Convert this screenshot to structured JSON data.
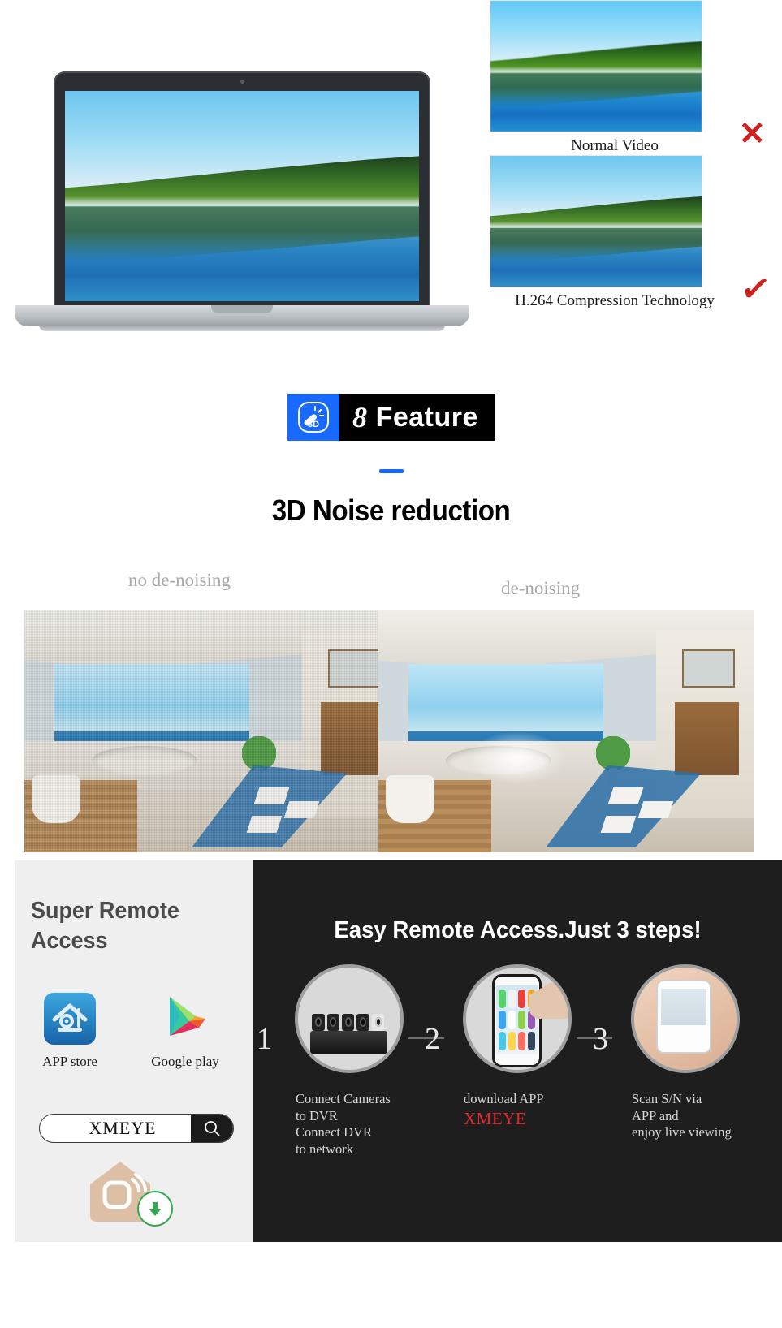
{
  "comparison": {
    "items": [
      {
        "caption": "Normal Video",
        "mark": "✕",
        "mark_name": "cross-mark",
        "quality": "normal"
      },
      {
        "caption": "H.264 Compression Technology",
        "mark": "✓",
        "mark_name": "check-mark",
        "quality": "compressed"
      }
    ],
    "mark_color": "#cf1f1f"
  },
  "feature_badge": {
    "icon_label": "3D",
    "number": "8",
    "label": "Feature",
    "icon_bg": "#1769ff",
    "label_bg": "#000000"
  },
  "noise_section": {
    "rule_color": "#1769ff",
    "title": "3D Noise reduction",
    "left_label": "no de-noising",
    "right_label": "de-noising"
  },
  "remote": {
    "left": {
      "title": "Super Remote Access",
      "stores": [
        {
          "name": "APP store",
          "icon": "xmeye-app-icon"
        },
        {
          "name": "Google play",
          "icon": "google-play-icon"
        }
      ],
      "search": {
        "value": "XMEYE",
        "placeholder": "XMEYE",
        "button_icon": "search-icon"
      },
      "download": {
        "icon": "xmeye-house-icon",
        "badge_icon": "download-arrow-icon",
        "badge_color": "#2fa84f"
      }
    },
    "right": {
      "title": "Easy Remote Access.Just 3 steps!",
      "steps": [
        {
          "number": "1",
          "image": "dvr-with-cameras",
          "lines": [
            "Connect Cameras",
            "to DVR",
            "Connect DVR",
            "to network"
          ],
          "highlight": ""
        },
        {
          "number": "2",
          "image": "smartphone-apps",
          "lines": [
            "download APP"
          ],
          "highlight": "XMEYE"
        },
        {
          "number": "3",
          "image": "hand-holding-phone",
          "lines": [
            "Scan S/N via",
            "APP and",
            "enjoy live viewing"
          ],
          "highlight": ""
        }
      ],
      "highlight_color": "#e8262d"
    }
  }
}
